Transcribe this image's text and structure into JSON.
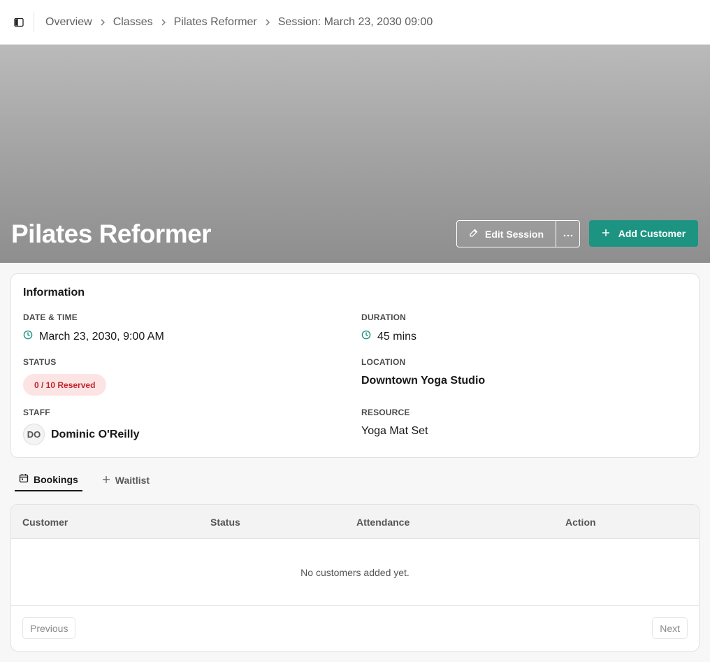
{
  "breadcrumb": {
    "items": [
      "Overview",
      "Classes",
      "Pilates Reformer",
      "Session: March 23, 2030 09:00"
    ]
  },
  "hero": {
    "title": "Pilates Reformer",
    "edit_label": "Edit Session",
    "add_label": "Add Customer"
  },
  "info": {
    "title": "Information",
    "date_label": "DATE & TIME",
    "date_value": "March 23, 2030, 9:00 AM",
    "duration_label": "DURATION",
    "duration_value": "45 mins",
    "status_label": "STATUS",
    "status_value": "0 / 10 Reserved",
    "location_label": "LOCATION",
    "location_value": "Downtown Yoga Studio",
    "staff_label": "STAFF",
    "staff_initials": "DO",
    "staff_name": "Dominic O'Reilly",
    "resource_label": "RESOURCE",
    "resource_value": "Yoga Mat Set"
  },
  "tabs": {
    "bookings": "Bookings",
    "waitlist": "Waitlist"
  },
  "table": {
    "headers": [
      "Customer",
      "Status",
      "Attendance",
      "Action"
    ],
    "empty": "No customers added yet.",
    "prev": "Previous",
    "next": "Next"
  },
  "colors": {
    "accent": "#1d9482",
    "badge_bg": "#fde4e4",
    "badge_text": "#c0262d"
  }
}
